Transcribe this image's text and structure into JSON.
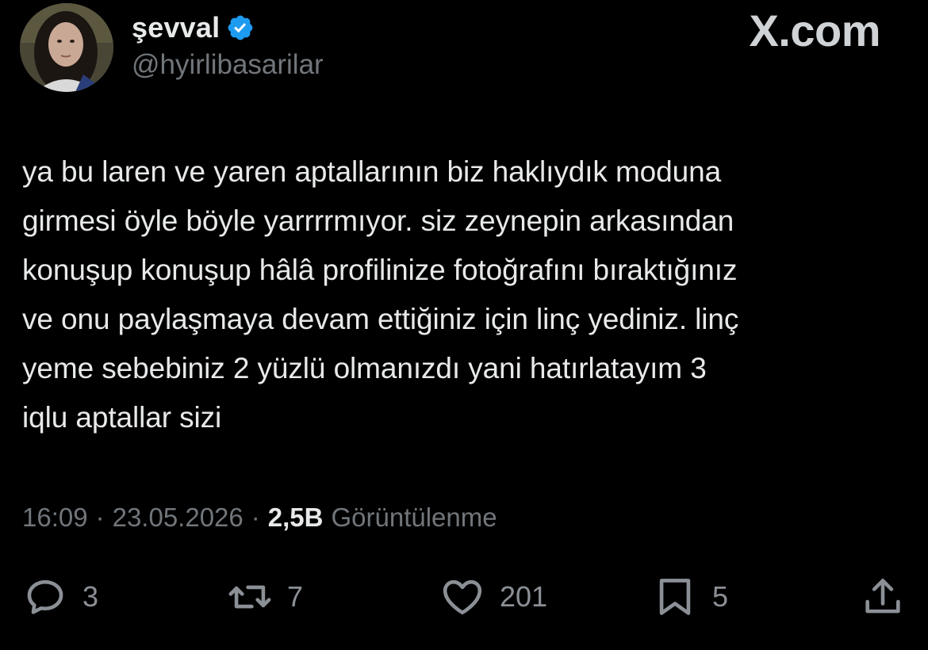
{
  "user": {
    "display_name": "şevval",
    "handle": "@hyirlibasarilar",
    "verified": true,
    "avatar_icon": "profile-photo"
  },
  "watermark": "X.com",
  "tweet": {
    "text": "ya bu laren ve yaren aptallarının biz haklıydık moduna\ngirmesi öyle böyle yarrrrmıyor. siz zeynepin arkasından\nkonuşup konuşup hâlâ profilinize fotoğrafını bıraktığınız\nve onu paylaşmaya devam ettiğiniz için linç yediniz. linç\nyeme sebebiniz 2 yüzlü olmanızdı yani hatırlatayım 3\niqlu aptallar sizi"
  },
  "meta": {
    "time": "16:09",
    "separator": "·",
    "date": "23.05.2026",
    "views_count": "2,5B",
    "views_label": "Görüntülenme"
  },
  "actions": {
    "replies": "3",
    "reposts": "7",
    "likes": "201",
    "bookmarks": "5"
  },
  "colors": {
    "background": "#000000",
    "text": "#e7e9ea",
    "muted": "#71767b",
    "verified": "#1d9bf0"
  }
}
